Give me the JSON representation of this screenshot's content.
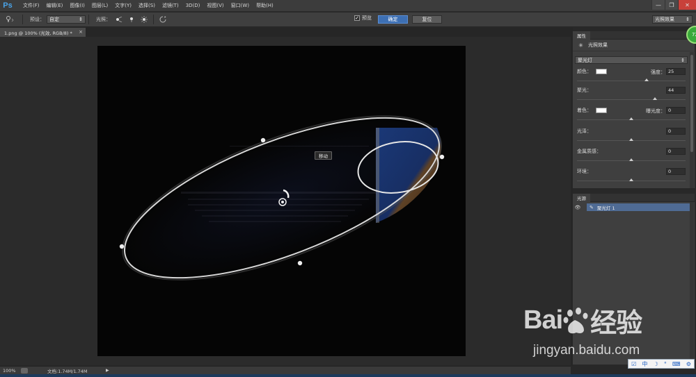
{
  "app": {
    "logo": "Ps",
    "menu": [
      "文件(F)",
      "编辑(E)",
      "图像(I)",
      "图层(L)",
      "文字(Y)",
      "选择(S)",
      "滤镜(T)",
      "3D(D)",
      "视图(V)",
      "窗口(W)",
      "帮助(H)"
    ],
    "window_controls": {
      "minimize": "—",
      "restore": "❐",
      "close": "✕"
    }
  },
  "options": {
    "preset_label": "预设：",
    "preset_value": "自定",
    "light_label": "光照：",
    "preview_label": "预览",
    "preview_checked": "✓",
    "ok_label": "确定",
    "reset_label": "复位",
    "workspace_value": "光照效果"
  },
  "document": {
    "tab_title": "1.png @ 100% (光效, RGB/8) *",
    "tab_close": "×",
    "tooltip": "移动"
  },
  "status": {
    "zoom": "100%",
    "doc_size": "文档:1.74M/1.74M",
    "arrow": "▶"
  },
  "properties": {
    "tab": "属性",
    "title": "光照效果",
    "light_type": "聚光灯",
    "color_label": "颜色：",
    "intensity_label": "强度：",
    "intensity_value": "25",
    "intensity_pos": 0.64,
    "hotspot_label": "聚光：",
    "hotspot_value": "44",
    "hotspot_pos": 0.72,
    "tint_label": "着色：",
    "exposure_label": "曝光度：",
    "exposure_value": "0",
    "exposure_pos": 0.5,
    "gloss_label": "光泽：",
    "gloss_value": "0",
    "gloss_pos": 0.5,
    "metallic_label": "金属质感：",
    "metallic_value": "0",
    "metallic_pos": 0.5,
    "ambience_label": "环境：",
    "ambience_value": "0",
    "ambience_pos": 0.5
  },
  "lights": {
    "tab": "光源",
    "items": [
      {
        "name": "聚光灯 1"
      }
    ]
  },
  "badge": "72",
  "watermark": {
    "logo_left": "Bai",
    "logo_right": "经验",
    "url": "jingyan.baidu.com"
  },
  "ime": [
    "☑",
    "中",
    "☽",
    "°",
    "⌨",
    "⚙"
  ],
  "colors": {
    "accent": "#3d6fb3",
    "selection": "#4f6b94",
    "panel": "#3f3f3f",
    "background": "#282828"
  }
}
